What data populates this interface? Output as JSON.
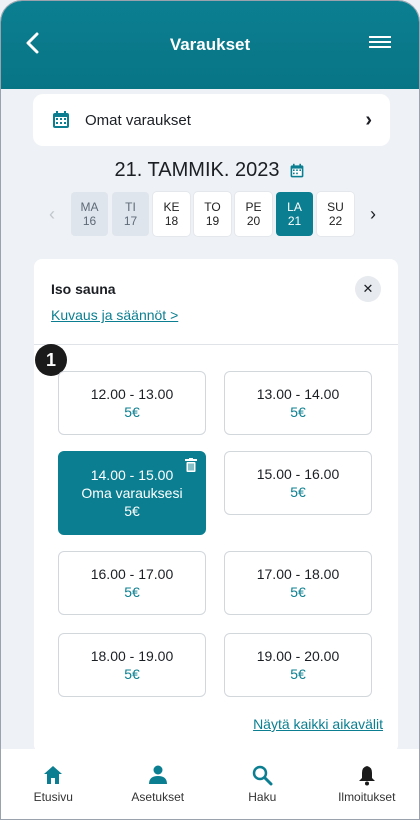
{
  "header": {
    "title": "Varaukset"
  },
  "own_bookings": {
    "label": "Omat varaukset"
  },
  "date_title": "21. TAMMIK. 2023",
  "week": [
    {
      "dow": "MA",
      "day": "16",
      "state": "past"
    },
    {
      "dow": "TI",
      "day": "17",
      "state": "past"
    },
    {
      "dow": "KE",
      "day": "18",
      "state": "normal"
    },
    {
      "dow": "TO",
      "day": "19",
      "state": "normal"
    },
    {
      "dow": "PE",
      "day": "20",
      "state": "normal"
    },
    {
      "dow": "LA",
      "day": "21",
      "state": "selected"
    },
    {
      "dow": "SU",
      "day": "22",
      "state": "normal"
    }
  ],
  "card": {
    "name": "Iso sauna",
    "desc_link": "Kuvaus ja säännöt >",
    "badge": "1",
    "show_all": "Näytä kaikki aikavälit"
  },
  "slots": [
    {
      "time": "12.00 - 13.00",
      "price": "5€"
    },
    {
      "time": "13.00 - 14.00",
      "price": "5€"
    },
    {
      "time": "14.00 - 15.00",
      "note": "Oma varauksesi",
      "price": "5€",
      "own": true
    },
    {
      "time": "15.00 - 16.00",
      "price": "5€"
    },
    {
      "time": "16.00 - 17.00",
      "price": "5€"
    },
    {
      "time": "17.00 - 18.00",
      "price": "5€"
    },
    {
      "time": "18.00 - 19.00",
      "price": "5€"
    },
    {
      "time": "19.00 - 20.00",
      "price": "5€"
    }
  ],
  "bottom_nav": [
    {
      "label": "Etusivu",
      "icon": "home-icon"
    },
    {
      "label": "Asetukset",
      "icon": "person-icon"
    },
    {
      "label": "Haku",
      "icon": "search-icon"
    },
    {
      "label": "Ilmoitukset",
      "icon": "bell-icon"
    }
  ],
  "colors": {
    "accent": "#0b7f91",
    "background": "#eef1f5"
  }
}
